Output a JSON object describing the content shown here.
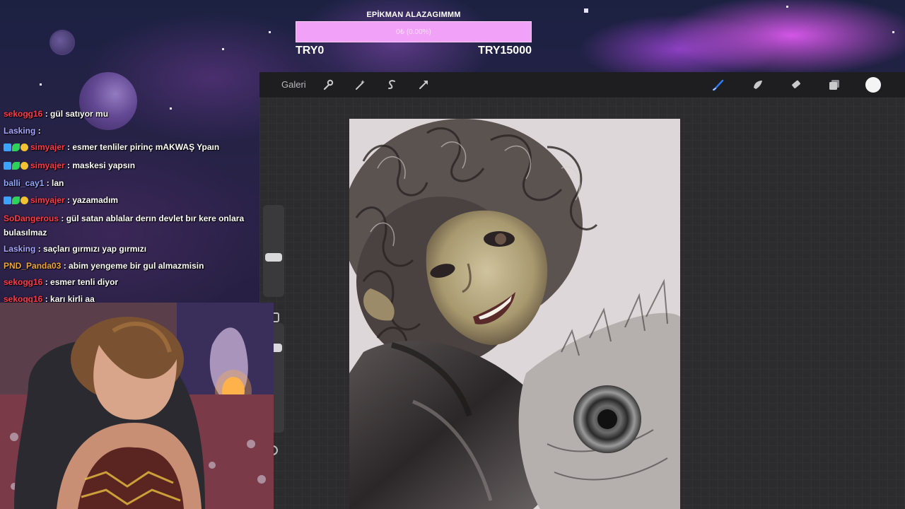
{
  "stream_overlay": {
    "goal": {
      "title": "EPİKMAN ALAZAGIMMM",
      "progress_text": "0₺ (0.00%)",
      "progress_fraction": 0.0,
      "min_label": "TRY0",
      "max_label": "TRY15000",
      "bar_color": "#f1a2f8"
    }
  },
  "app": {
    "toolbar": {
      "gallery_label": "Galeri",
      "left_icons": [
        "wrench-icon",
        "magic-wand-icon",
        "selection-s-icon",
        "transform-arrow-icon"
      ],
      "right_icons": [
        "brush-icon",
        "smudge-icon",
        "eraser-icon",
        "layers-icon"
      ],
      "active_color": "#f4f4f4",
      "active_tool": "brush"
    },
    "sidebar": {
      "brush_size_level": 0.58,
      "opacity_level": 0.2
    }
  },
  "chat": {
    "messages": [
      {
        "user": "sekogg16",
        "user_color": "#ff3b4a",
        "badges": false,
        "text": ": gül satıyor mu"
      },
      {
        "user": "Lasking",
        "user_color": "#a9a6ff",
        "badges": false,
        "text": ": "
      },
      {
        "user": "simyajer",
        "user_color": "#ff3b4a",
        "badges": true,
        "text": ": esmer tenliler pirinç mAKWAŞ Ypaın"
      },
      {
        "user": "simyajer",
        "user_color": "#ff3b4a",
        "badges": true,
        "text": ": maskesi yapsın"
      },
      {
        "user": "balli_cay1",
        "user_color": "#8fa8ff",
        "badges": false,
        "text": ": lan"
      },
      {
        "user": "simyajer",
        "user_color": "#ff3b4a",
        "badges": true,
        "text": ": yazamadım"
      },
      {
        "user": "SoDangerous",
        "user_color": "#ff3b4a",
        "badges": false,
        "text": ": gül satan ablalar derın devlet bır kere onlara bulasılmaz"
      },
      {
        "user": "Lasking",
        "user_color": "#a9a6ff",
        "badges": false,
        "text": ": saçları gırmızı yap gırmızı"
      },
      {
        "user": "PND_Panda03",
        "user_color": "#f0a63a",
        "badges": false,
        "text": ": abim yengeme bir gul almazmisin"
      },
      {
        "user": "sekogg16",
        "user_color": "#ff3b4a",
        "badges": false,
        "text": ": esmer tenli diyor"
      },
      {
        "user": "sekogg16",
        "user_color": "#ff3b4a",
        "badges": false,
        "text": ": karı kirli aa"
      }
    ]
  }
}
